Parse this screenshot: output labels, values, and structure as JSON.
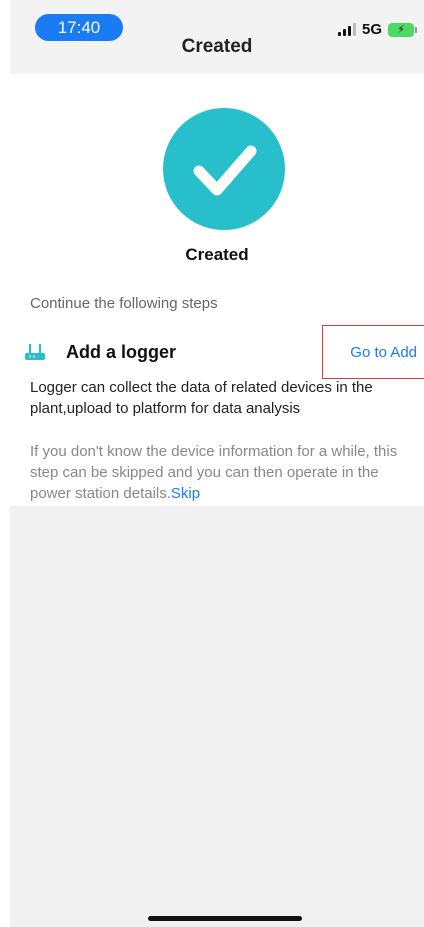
{
  "status_bar": {
    "time": "17:40",
    "network": "5G",
    "battery_icon": "battery-charging-icon"
  },
  "nav": {
    "title": "Created"
  },
  "success": {
    "icon": "check-circle-icon",
    "heading": "Created",
    "accent_color": "#27bfcc"
  },
  "steps": {
    "hint": "Continue the following steps",
    "logger": {
      "icon": "router-icon",
      "title": "Add a logger",
      "action_label": "Go to Add",
      "description": "Logger can collect the data of related devices in the plant,upload to platform for data analysis"
    },
    "skip_note": "If you don't know the device information for a while, this step can be skipped and you can then operate in the power station details.",
    "skip_label": "Skip"
  },
  "colors": {
    "link": "#1a7cf5",
    "highlight_box": "#e53935"
  }
}
